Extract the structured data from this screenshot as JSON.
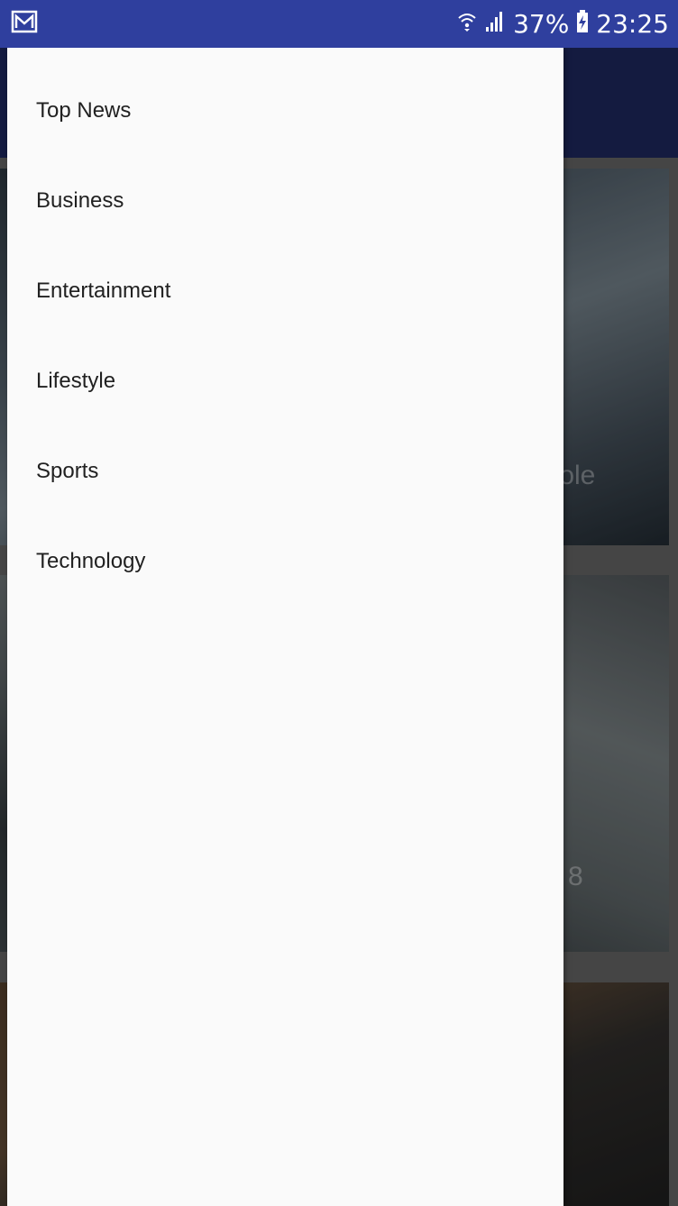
{
  "status_bar": {
    "notification_icon": "gallery-notification-icon",
    "wifi_icon": "wifi-icon",
    "signal_icon": "signal-icon",
    "battery_percent": "37%",
    "battery_icon": "battery-charging-icon",
    "time": "23:25",
    "background_color": "#2f3f9e"
  },
  "drawer": {
    "items": [
      {
        "label": "Top News"
      },
      {
        "label": "Business"
      },
      {
        "label": "Entertainment"
      },
      {
        "label": "Lifestyle"
      },
      {
        "label": "Sports"
      },
      {
        "label": "Technology"
      }
    ]
  },
  "background_app": {
    "toolbar_color": "#1b2556",
    "cards": [
      {
        "title_fragment": "tole"
      },
      {
        "title_fragment": "8"
      },
      {
        "title_fragment": ""
      }
    ]
  }
}
